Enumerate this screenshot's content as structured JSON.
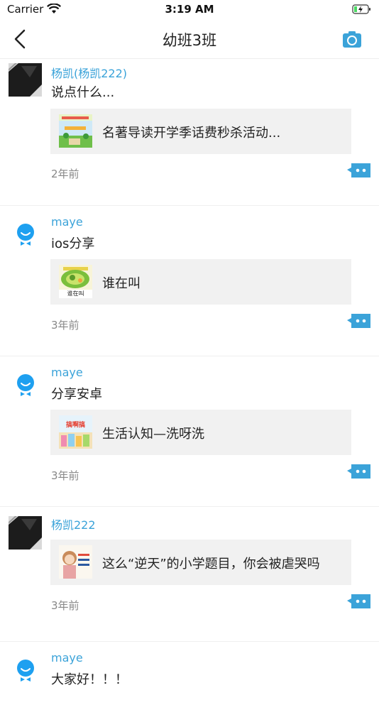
{
  "status_bar": {
    "carrier": "Carrier",
    "time": "3:19 AM"
  },
  "nav": {
    "title": "幼班3班",
    "back_icon": "chevron-left-icon",
    "camera_icon": "camera-icon"
  },
  "colors": {
    "accent": "#3ba3d9",
    "card_bg": "#f1f1f1",
    "time_text": "#888888"
  },
  "posts": [
    {
      "author": "杨凯(杨凯222)",
      "content": "说点什么...",
      "share_title": "名著导读开学季话费秒杀活动...",
      "time": "2年前",
      "avatar": "photo"
    },
    {
      "author": "maye",
      "content": "ios分享",
      "share_title": "谁在叫",
      "thumb_caption": "谁在叫",
      "time": "3年前",
      "avatar": "default"
    },
    {
      "author": "maye",
      "content": "分享安卓",
      "share_title": "生活认知—洗呀洗",
      "thumb_caption": "搞啊搞",
      "time": "3年前",
      "avatar": "default"
    },
    {
      "author": "杨凯222",
      "content": "",
      "share_title": "这么“逆天”的小学题目，你会被虐哭吗",
      "time": "3年前",
      "avatar": "photo"
    },
    {
      "author": "maye",
      "content": "大家好！！！",
      "avatar": "default"
    }
  ]
}
